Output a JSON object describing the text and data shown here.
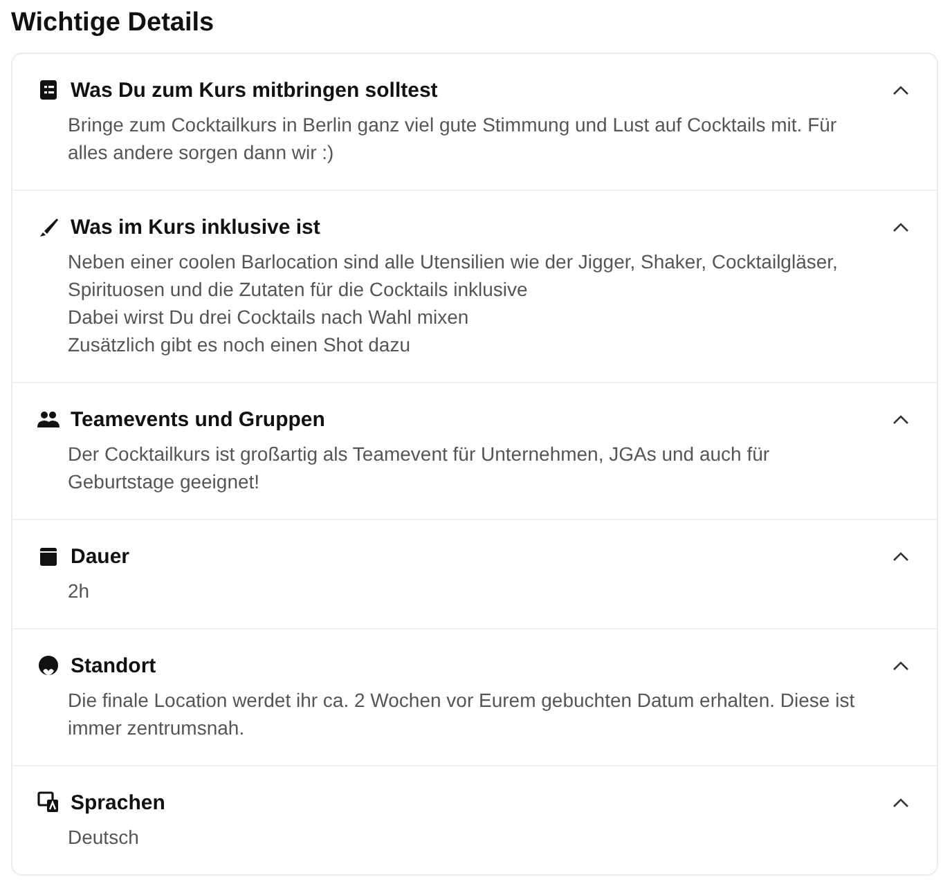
{
  "title": "Wichtige Details",
  "sections": [
    {
      "title": "Was Du zum Kurs mitbringen solltest",
      "expanded": true,
      "paragraphs": [
        "Bringe zum Cocktailkurs in Berlin ganz viel gute Stimmung und Lust auf Cocktails mit. Für alles andere sorgen dann wir :)"
      ]
    },
    {
      "title": "Was im Kurs inklusive ist",
      "expanded": true,
      "paragraphs": [
        "Neben einer coolen Barlocation sind alle Utensilien wie der Jigger, Shaker, Cocktailgläser, Spirituosen und die Zutaten für die Cocktails inklusive",
        "Dabei wirst Du drei Cocktails nach Wahl mixen",
        "Zusätzlich gibt es noch einen Shot dazu"
      ]
    },
    {
      "title": "Teamevents und Gruppen",
      "expanded": true,
      "paragraphs": [
        "Der Cocktailkurs ist großartig als Teamevent für Unternehmen, JGAs und auch für Geburtstage geeignet!"
      ]
    },
    {
      "title": "Dauer",
      "expanded": true,
      "paragraphs": [
        "2h"
      ]
    },
    {
      "title": "Standort",
      "expanded": true,
      "paragraphs": [
        "Die finale Location werdet ihr ca. 2 Wochen vor Eurem gebuchten Datum erhalten. Diese ist immer zentrumsnah."
      ]
    },
    {
      "title": "Sprachen",
      "expanded": true,
      "paragraphs": [
        "Deutsch"
      ]
    }
  ]
}
